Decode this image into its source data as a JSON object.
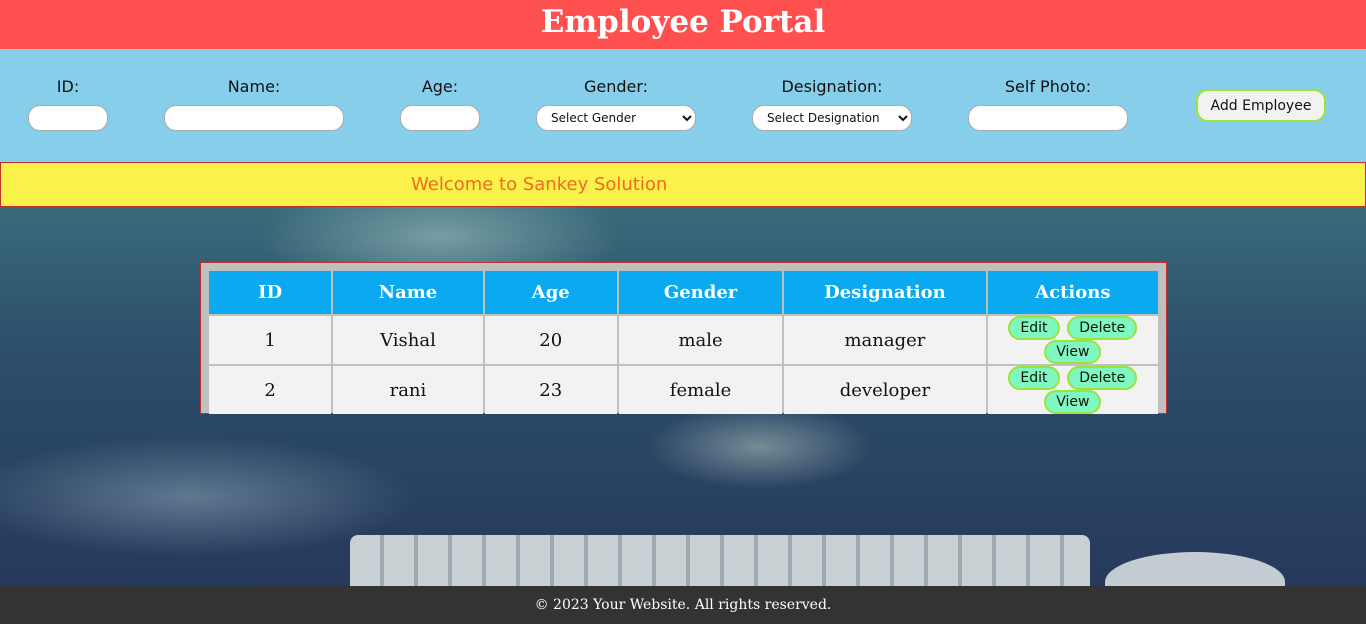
{
  "header": {
    "title": "Employee Portal"
  },
  "form": {
    "id_label": "ID:",
    "name_label": "Name:",
    "age_label": "Age:",
    "gender_label": "Gender:",
    "gender_selected": "Select Gender",
    "designation_label": "Designation:",
    "designation_selected": "Select Designation",
    "photo_label": "Self Photo:",
    "add_button": "Add Employee"
  },
  "welcome": {
    "text": "Welcome to Sankey Solution"
  },
  "table": {
    "headers": [
      "ID",
      "Name",
      "Age",
      "Gender",
      "Designation",
      "Actions"
    ],
    "rows": [
      {
        "id": "1",
        "name": "Vishal",
        "age": "20",
        "gender": "male",
        "designation": "manager"
      },
      {
        "id": "2",
        "name": "rani",
        "age": "23",
        "gender": "female",
        "designation": "developer"
      }
    ],
    "actions": {
      "edit": "Edit",
      "delete": "Delete",
      "view": "View"
    }
  },
  "footer": {
    "text": "© 2023 Your Website. All rights reserved."
  },
  "colors": {
    "header": "#ff5050",
    "form_bar": "#87ceeb",
    "welcome_bar": "#f8f24a",
    "welcome_text": "#f26b21",
    "table_header": "#0aa9f0",
    "action_button": "#7ef7c0",
    "footer": "#333333"
  }
}
